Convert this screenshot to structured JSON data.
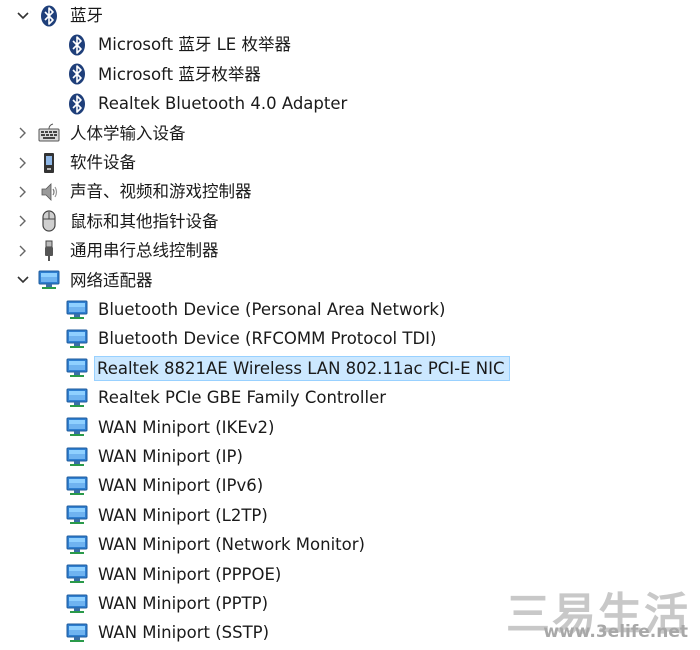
{
  "tree": [
    {
      "id": "bt",
      "level": 0,
      "expanded": true,
      "icon": "bluetooth-icon",
      "label": "蓝牙"
    },
    {
      "id": "bt-le",
      "level": 1,
      "icon": "bluetooth-icon",
      "label": "Microsoft 蓝牙 LE 枚举器"
    },
    {
      "id": "bt-enum",
      "level": 1,
      "icon": "bluetooth-icon",
      "label": "Microsoft 蓝牙枚举器"
    },
    {
      "id": "bt-realtek",
      "level": 1,
      "icon": "bluetooth-icon",
      "label": "Realtek Bluetooth 4.0 Adapter"
    },
    {
      "id": "hid",
      "level": 0,
      "expanded": false,
      "icon": "keyboard-icon",
      "label": "人体学输入设备"
    },
    {
      "id": "sw",
      "level": 0,
      "expanded": false,
      "icon": "software-device-icon",
      "label": "软件设备"
    },
    {
      "id": "audio",
      "level": 0,
      "expanded": false,
      "icon": "speaker-icon",
      "label": "声音、视频和游戏控制器"
    },
    {
      "id": "mouse",
      "level": 0,
      "expanded": false,
      "icon": "mouse-icon",
      "label": "鼠标和其他指针设备"
    },
    {
      "id": "usb",
      "level": 0,
      "expanded": false,
      "icon": "usb-icon",
      "label": "通用串行总线控制器"
    },
    {
      "id": "net",
      "level": 0,
      "expanded": true,
      "icon": "network-icon",
      "label": "网络适配器"
    },
    {
      "id": "net-1",
      "level": 1,
      "icon": "network-icon",
      "label": "Bluetooth Device (Personal Area Network)"
    },
    {
      "id": "net-2",
      "level": 1,
      "icon": "network-icon",
      "label": "Bluetooth Device (RFCOMM Protocol TDI)"
    },
    {
      "id": "net-3",
      "level": 1,
      "icon": "network-icon",
      "label": "Realtek 8821AE Wireless LAN 802.11ac PCI-E NIC",
      "selected": true
    },
    {
      "id": "net-4",
      "level": 1,
      "icon": "network-icon",
      "label": "Realtek PCIe GBE Family Controller"
    },
    {
      "id": "net-5",
      "level": 1,
      "icon": "network-icon",
      "label": "WAN Miniport (IKEv2)"
    },
    {
      "id": "net-6",
      "level": 1,
      "icon": "network-icon",
      "label": "WAN Miniport (IP)"
    },
    {
      "id": "net-7",
      "level": 1,
      "icon": "network-icon",
      "label": "WAN Miniport (IPv6)"
    },
    {
      "id": "net-8",
      "level": 1,
      "icon": "network-icon",
      "label": "WAN Miniport (L2TP)"
    },
    {
      "id": "net-9",
      "level": 1,
      "icon": "network-icon",
      "label": "WAN Miniport (Network Monitor)"
    },
    {
      "id": "net-10",
      "level": 1,
      "icon": "network-icon",
      "label": "WAN Miniport (PPPOE)"
    },
    {
      "id": "net-11",
      "level": 1,
      "icon": "network-icon",
      "label": "WAN Miniport (PPTP)"
    },
    {
      "id": "net-12",
      "level": 1,
      "icon": "network-icon",
      "label": "WAN Miniport (SSTP)"
    }
  ],
  "watermark": {
    "cn": "三易生活",
    "url": "www.3elife.net"
  },
  "colors": {
    "selection_bg": "#cce8ff",
    "selection_border": "#99d1ff",
    "text": "#1a1a1a"
  }
}
